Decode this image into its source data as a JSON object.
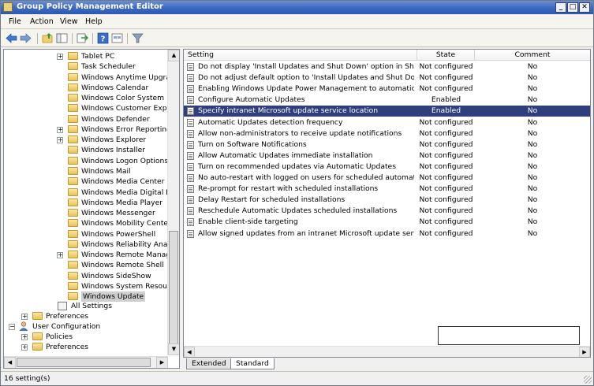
{
  "window": {
    "title": "Group Policy Management Editor",
    "controls": [
      "_",
      "□",
      "✕"
    ]
  },
  "menu": [
    "File",
    "Action",
    "View",
    "Help"
  ],
  "toolbar": {
    "icons": [
      "back-icon",
      "forward-icon",
      "up-folder-icon",
      "show-tree-icon",
      "export-icon",
      "help-icon",
      "view-icon",
      "filter-icon"
    ]
  },
  "tree": {
    "items": [
      {
        "label": "Tablet PC",
        "expander": "+"
      },
      {
        "label": "Task Scheduler",
        "expander": ""
      },
      {
        "label": "Windows Anytime Upgrade",
        "expander": ""
      },
      {
        "label": "Windows Calendar",
        "expander": ""
      },
      {
        "label": "Windows Color System",
        "expander": ""
      },
      {
        "label": "Windows Customer Experier",
        "expander": ""
      },
      {
        "label": "Windows Defender",
        "expander": ""
      },
      {
        "label": "Windows Error Reporting",
        "expander": "+"
      },
      {
        "label": "Windows Explorer",
        "expander": "+"
      },
      {
        "label": "Windows Installer",
        "expander": ""
      },
      {
        "label": "Windows Logon Options",
        "expander": ""
      },
      {
        "label": "Windows Mail",
        "expander": ""
      },
      {
        "label": "Windows Media Center",
        "expander": ""
      },
      {
        "label": "Windows Media Digital Right",
        "expander": ""
      },
      {
        "label": "Windows Media Player",
        "expander": ""
      },
      {
        "label": "Windows Messenger",
        "expander": ""
      },
      {
        "label": "Windows Mobility Center",
        "expander": ""
      },
      {
        "label": "Windows PowerShell",
        "expander": ""
      },
      {
        "label": "Windows Reliability Analysis",
        "expander": ""
      },
      {
        "label": "Windows Remote Manageme",
        "expander": "+"
      },
      {
        "label": "Windows Remote Shell",
        "expander": ""
      },
      {
        "label": "Windows SideShow",
        "expander": ""
      },
      {
        "label": "Windows System Resource I",
        "expander": ""
      },
      {
        "label": "Windows Update",
        "expander": "",
        "selected": true
      }
    ],
    "all_settings": "All Settings",
    "preferences_1": "Preferences",
    "user_configuration": "User Configuration",
    "policies": "Policies",
    "preferences_2": "Preferences"
  },
  "list": {
    "columns": {
      "setting": "Setting",
      "state": "State",
      "comment": "Comment"
    },
    "rows": [
      {
        "setting": "Do not display 'Install Updates and Shut Down' option in Shut Do...",
        "state": "Not configured",
        "comment": "No"
      },
      {
        "setting": "Do not adjust default option to 'Install Updates and Shut Down' in...",
        "state": "Not configured",
        "comment": "No"
      },
      {
        "setting": "Enabling Windows Update Power Management to automatically w...",
        "state": "Not configured",
        "comment": "No"
      },
      {
        "setting": "Configure Automatic Updates",
        "state": "Enabled",
        "comment": "No"
      },
      {
        "setting": "Specify intranet Microsoft update service location",
        "state": "Enabled",
        "comment": "No",
        "selected": true
      },
      {
        "setting": "Automatic Updates detection frequency",
        "state": "Not configured",
        "comment": "No"
      },
      {
        "setting": "Allow non-administrators to receive update notifications",
        "state": "Not configured",
        "comment": "No"
      },
      {
        "setting": "Turn on Software Notifications",
        "state": "Not configured",
        "comment": "No"
      },
      {
        "setting": "Allow Automatic Updates immediate installation",
        "state": "Not configured",
        "comment": "No"
      },
      {
        "setting": "Turn on recommended updates via Automatic Updates",
        "state": "Not configured",
        "comment": "No"
      },
      {
        "setting": "No auto-restart with logged on users for scheduled automatic up...",
        "state": "Not configured",
        "comment": "No"
      },
      {
        "setting": "Re-prompt for restart with scheduled installations",
        "state": "Not configured",
        "comment": "No"
      },
      {
        "setting": "Delay Restart for scheduled installations",
        "state": "Not configured",
        "comment": "No"
      },
      {
        "setting": "Reschedule Automatic Updates scheduled installations",
        "state": "Not configured",
        "comment": "No"
      },
      {
        "setting": "Enable client-side targeting",
        "state": "Not configured",
        "comment": "No"
      },
      {
        "setting": "Allow signed updates from an intranet Microsoft update service lo...",
        "state": "Not configured",
        "comment": "No"
      }
    ]
  },
  "tabs": [
    {
      "label": "Extended",
      "active": false
    },
    {
      "label": "Standard",
      "active": true
    }
  ],
  "status": {
    "text": "16 setting(s)"
  }
}
